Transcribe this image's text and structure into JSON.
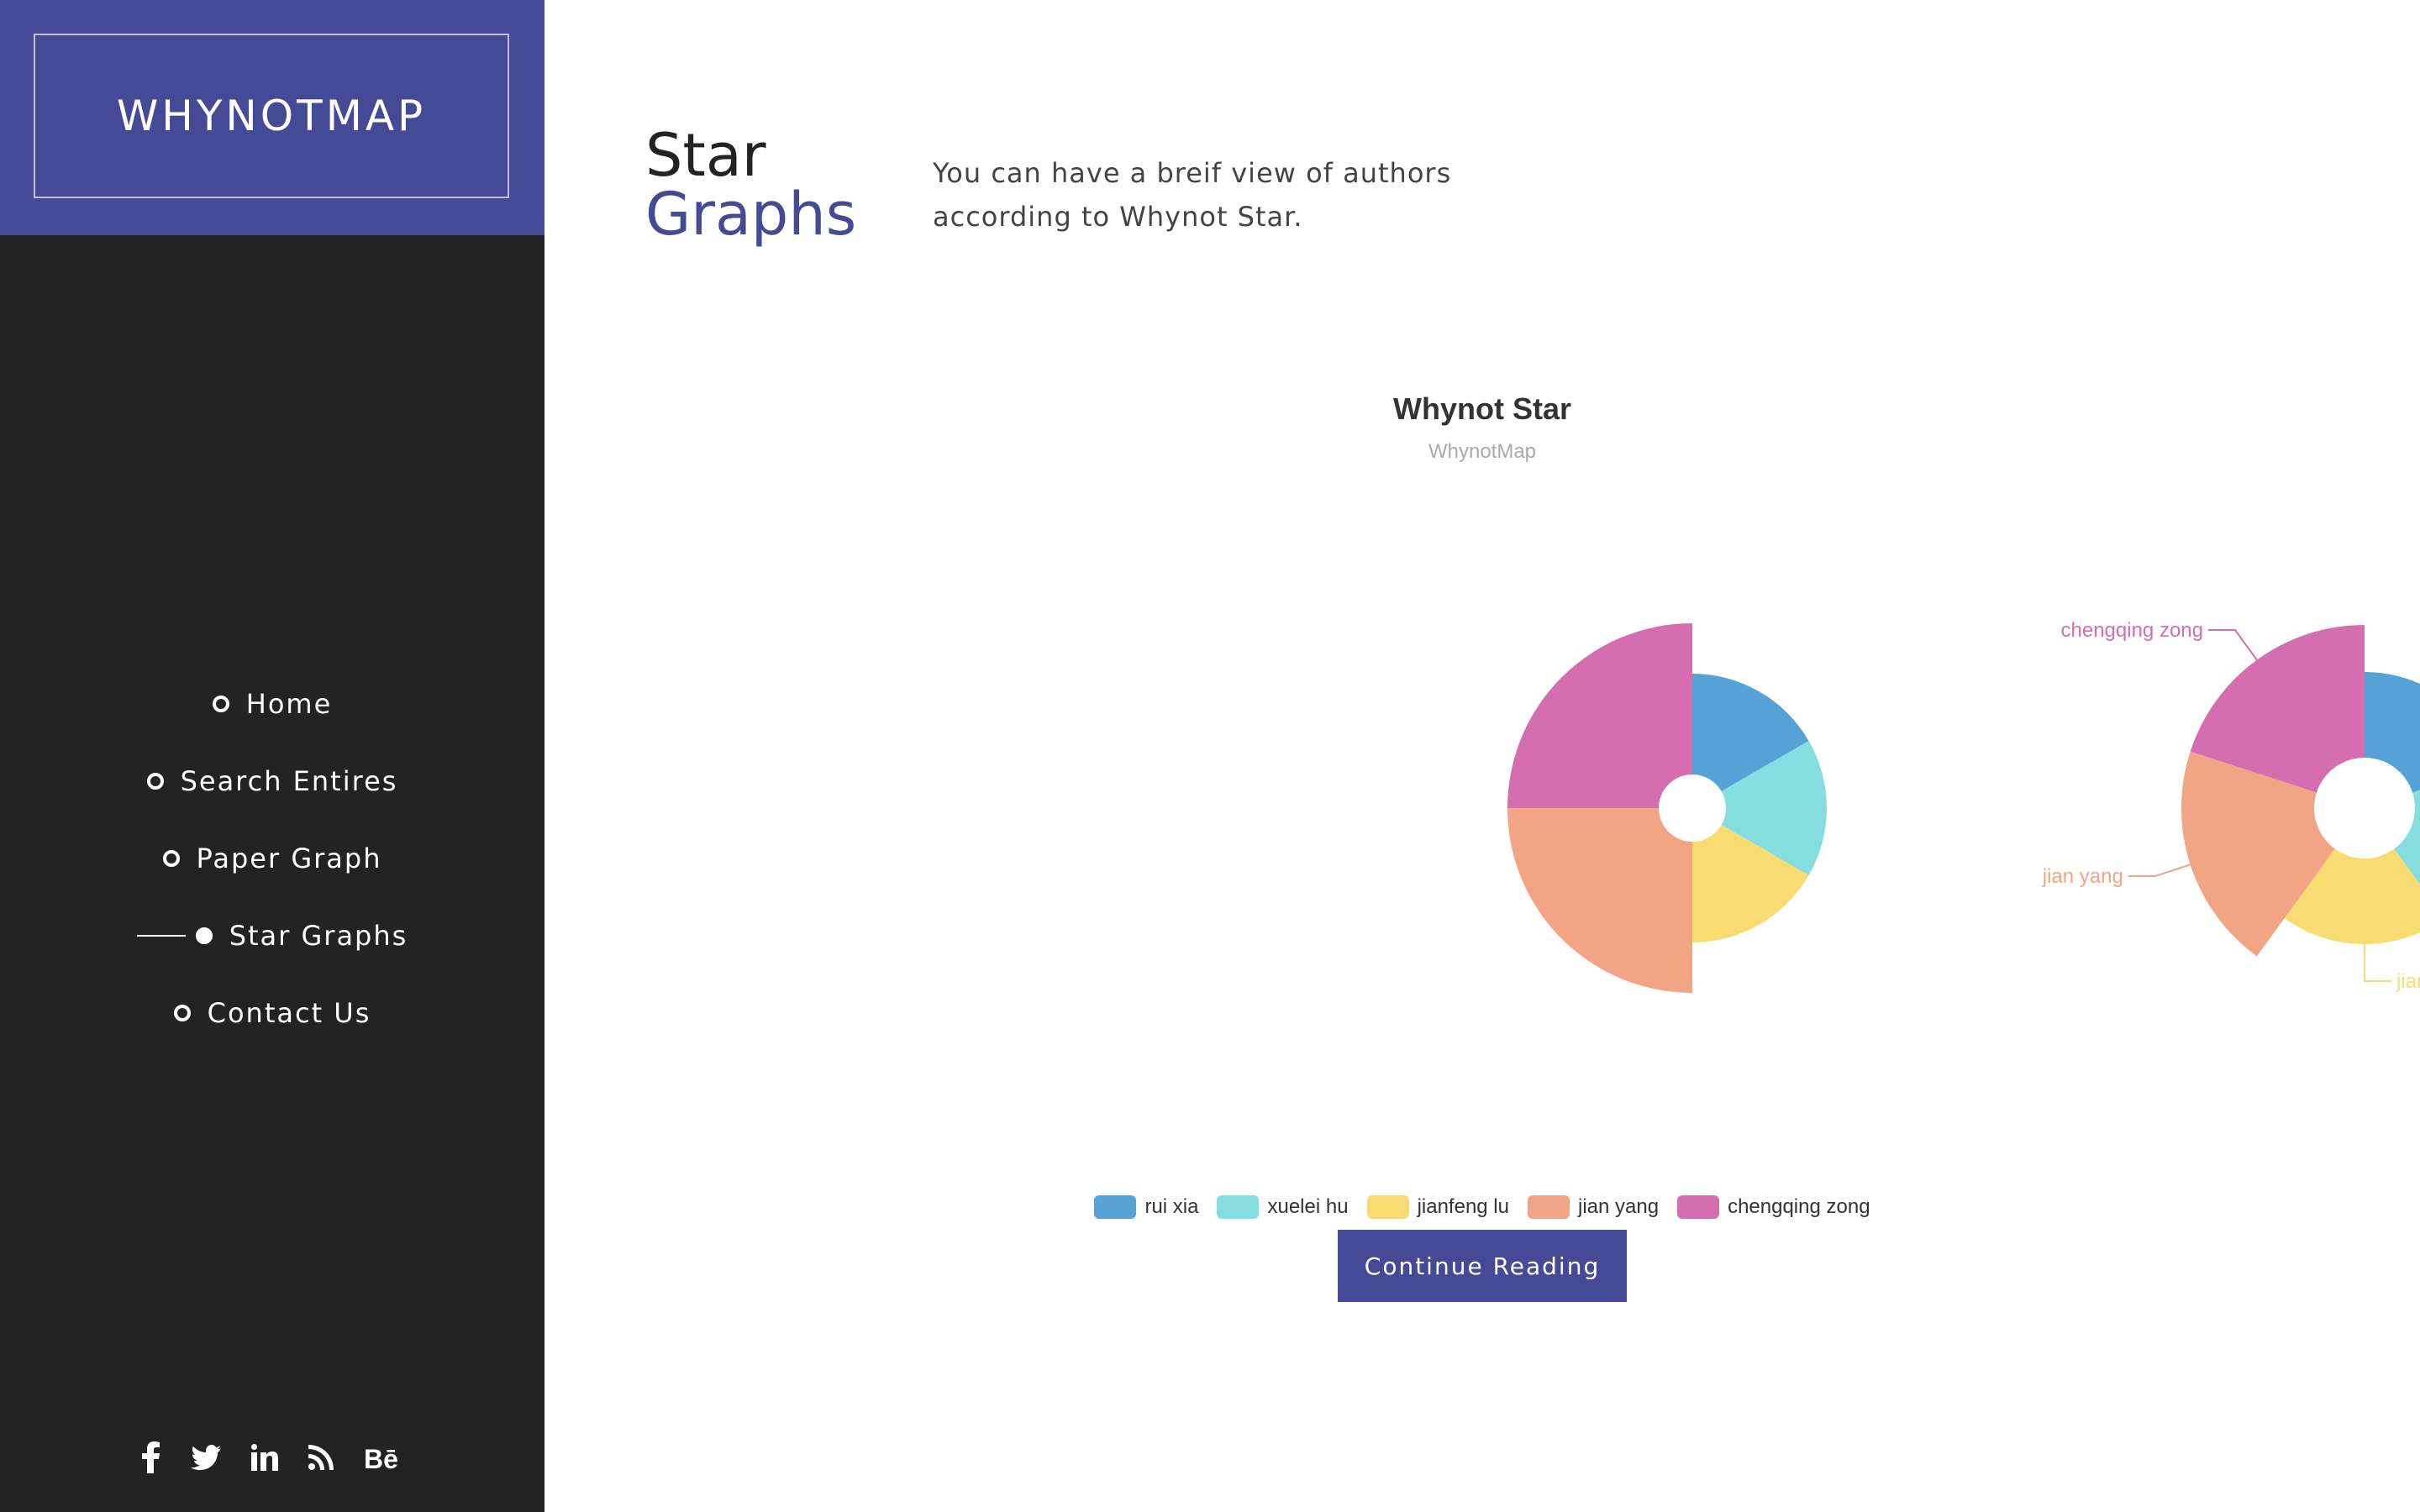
{
  "brand": {
    "name": "WHYNOTMAP"
  },
  "nav": {
    "items": [
      {
        "label": "Home",
        "active": false
      },
      {
        "label": "Search Entires",
        "active": false
      },
      {
        "label": "Paper Graph",
        "active": false
      },
      {
        "label": "Star Graphs",
        "active": true
      },
      {
        "label": "Contact Us",
        "active": false
      }
    ]
  },
  "social": [
    {
      "icon": "facebook-icon",
      "glyph": "f"
    },
    {
      "icon": "twitter-icon",
      "glyph": "🐦"
    },
    {
      "icon": "linkedin-icon",
      "glyph": "in"
    },
    {
      "icon": "rss-icon",
      "glyph": "rss"
    },
    {
      "icon": "behance-icon",
      "glyph": "Bē"
    }
  ],
  "header": {
    "title_line1": "Star",
    "title_line2": "Graphs",
    "intro": "You can have a breif view of authors according to Whynot Star."
  },
  "colors": {
    "accent": "#454a96",
    "sidebar": "#232323",
    "series": [
      "#56a2d6",
      "#85dde0",
      "#f9dc71",
      "#f2a585",
      "#d46eb0"
    ]
  },
  "chart_data": {
    "type": "pie",
    "variant": "nightingale-rose",
    "title": "Whynot Star",
    "subtitle": "WhynotMap",
    "categories": [
      "rui xia",
      "xuelei hu",
      "jianfeng lu",
      "jian yang",
      "chengqing zong"
    ],
    "charts": [
      {
        "name": "",
        "rose_type": "radius",
        "values": [
          20,
          20,
          20,
          30,
          30
        ]
      },
      {
        "name": "",
        "rose_type": "area",
        "values": [
          10,
          10,
          10,
          15,
          15
        ],
        "labels_shown": true
      }
    ],
    "legend": "bottom-center"
  },
  "cta": {
    "label": "Continue Reading"
  }
}
